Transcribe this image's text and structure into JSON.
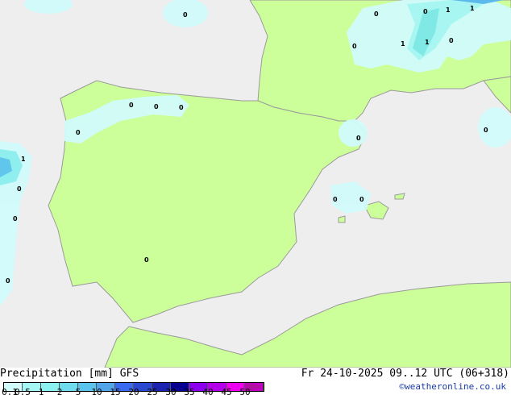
{
  "map": {
    "colors": {
      "land": "#ccff99",
      "sea": "#eeeeee",
      "precip_light": "#d2fbfb",
      "precip_mid": "#a6f6f6",
      "precip_dark": "#7ee8ea",
      "precip_heavy": "#58b8f0",
      "border": "#9a9a9a"
    },
    "value_labels": [
      "0",
      "0",
      "0",
      "0",
      "0",
      "0",
      "0",
      "0",
      "0",
      "0",
      "0",
      "0",
      "0",
      "0",
      "0",
      "0",
      "0",
      "1",
      "1",
      "1",
      "1",
      "1"
    ]
  },
  "footer": {
    "title": "Precipitation [mm] GFS",
    "datetime": "Fr 24-10-2025 09..12 UTC (06+318)",
    "credit": "©weatheronline.co.uk"
  },
  "colorbar": {
    "ticks": [
      "0.1",
      "0.5",
      "1",
      "2",
      "5",
      "10",
      "15",
      "20",
      "25",
      "30",
      "35",
      "40",
      "45",
      "50"
    ],
    "colors": [
      "#d2fbfb",
      "#a6f6f6",
      "#8af0f0",
      "#6edcec",
      "#5ac4ec",
      "#52a6e8",
      "#3a6af0",
      "#2a48d0",
      "#1a24b0",
      "#08008e",
      "#8c00f0",
      "#b400e8",
      "#f000f0",
      "#c000c0"
    ]
  }
}
